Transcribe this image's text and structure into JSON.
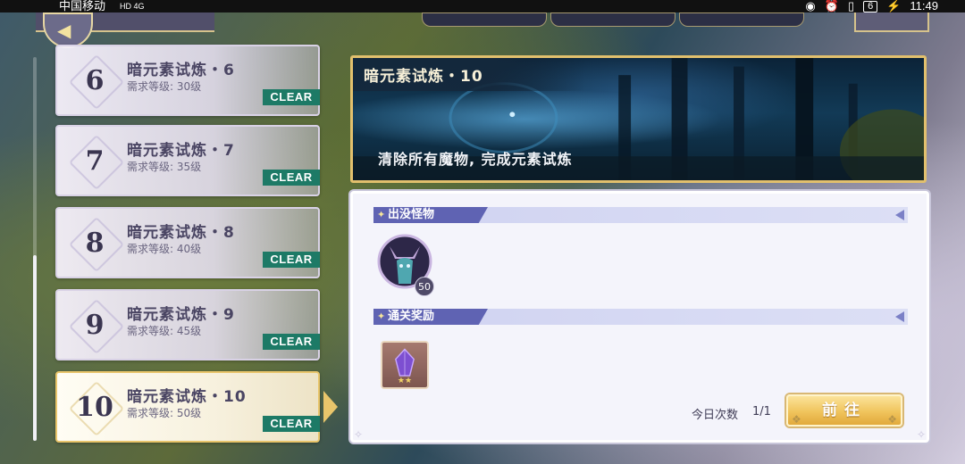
{
  "status_bar": {
    "carrier": "中国移动",
    "network_icons": "HD 4G",
    "battery_level": "6",
    "time": "11:49"
  },
  "top_bar": {
    "back_icon": "chevron-left-icon"
  },
  "stage_list": [
    {
      "number": "6",
      "title": "暗元素试炼・6",
      "requirement": "需求等级: 30级",
      "badge": "CLEAR",
      "selected": false
    },
    {
      "number": "7",
      "title": "暗元素试炼・7",
      "requirement": "需求等级: 35级",
      "badge": "CLEAR",
      "selected": false
    },
    {
      "number": "8",
      "title": "暗元素试炼・8",
      "requirement": "需求等级: 40级",
      "badge": "CLEAR",
      "selected": false
    },
    {
      "number": "9",
      "title": "暗元素试炼・9",
      "requirement": "需求等级: 45级",
      "badge": "CLEAR",
      "selected": false
    },
    {
      "number": "10",
      "title": "暗元素试炼・10",
      "requirement": "需求等级: 50级",
      "badge": "CLEAR",
      "selected": true
    }
  ],
  "detail": {
    "banner_title": "暗元素试炼・10",
    "banner_description": "清除所有魔物, 完成元素试炼",
    "monsters_section_label": "出没怪物",
    "monster_level": "50",
    "rewards_section_label": "通关奖励",
    "reward_stars": "★★",
    "daily_attempts_label": "今日次数",
    "daily_attempts_value": "1/1",
    "go_button_label": "前往"
  },
  "colors": {
    "accent_gold": "#e9c56b",
    "clear_badge": "#1d7a66",
    "section_label": "#5f63b3"
  }
}
